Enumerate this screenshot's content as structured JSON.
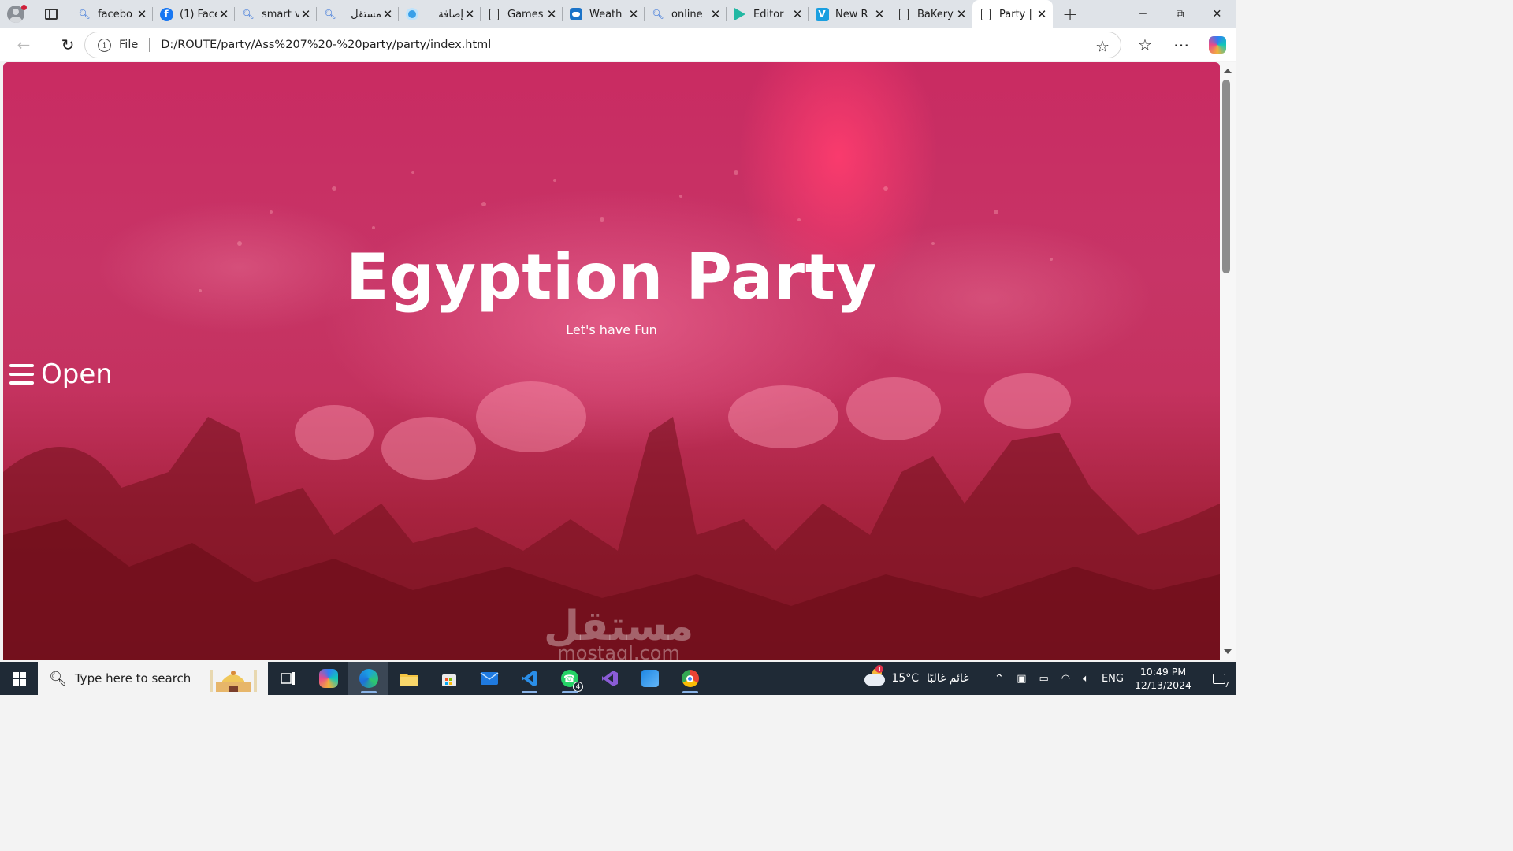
{
  "browser": {
    "tabs": [
      {
        "title": "facebo",
        "icon": "search-icon"
      },
      {
        "title": "(1) Face",
        "icon": "facebook-icon"
      },
      {
        "title": "smart v",
        "icon": "search-icon"
      },
      {
        "title": "مستقل",
        "icon": "search-icon"
      },
      {
        "title": "إضافة",
        "icon": "extension-icon"
      },
      {
        "title": "Games",
        "icon": "document-icon"
      },
      {
        "title": "Weath",
        "icon": "weather-icon"
      },
      {
        "title": "online",
        "icon": "search-icon"
      },
      {
        "title": "Editor",
        "icon": "play-icon"
      },
      {
        "title": "New R",
        "icon": "v-icon"
      },
      {
        "title": "BaKery",
        "icon": "document-icon"
      },
      {
        "title": "Party |",
        "icon": "document-icon",
        "active": true
      }
    ],
    "file_label": "File",
    "url": "D:/ROUTE/party/Ass%207%20-%20party/party/index.html"
  },
  "page": {
    "title": "Egyption Party",
    "subtitle": "Let's have Fun",
    "open_label": "Open",
    "watermark_ar": "مستقل",
    "watermark_latin": "mostaql.com"
  },
  "taskbar": {
    "search_placeholder": "Type here to search",
    "whatsapp_badge": "4",
    "weather_alert": "1",
    "temperature": "15°C",
    "weather_text": "غائم غالبًا",
    "language": "ENG",
    "time": "10:49 PM",
    "date": "12/13/2024",
    "notifications": "7"
  },
  "colors": {
    "hero_pink": "#c92b62",
    "hero_dark": "#8d1a2c",
    "tabstrip": "#dfe3e8",
    "taskbar": "#1f2a36"
  }
}
